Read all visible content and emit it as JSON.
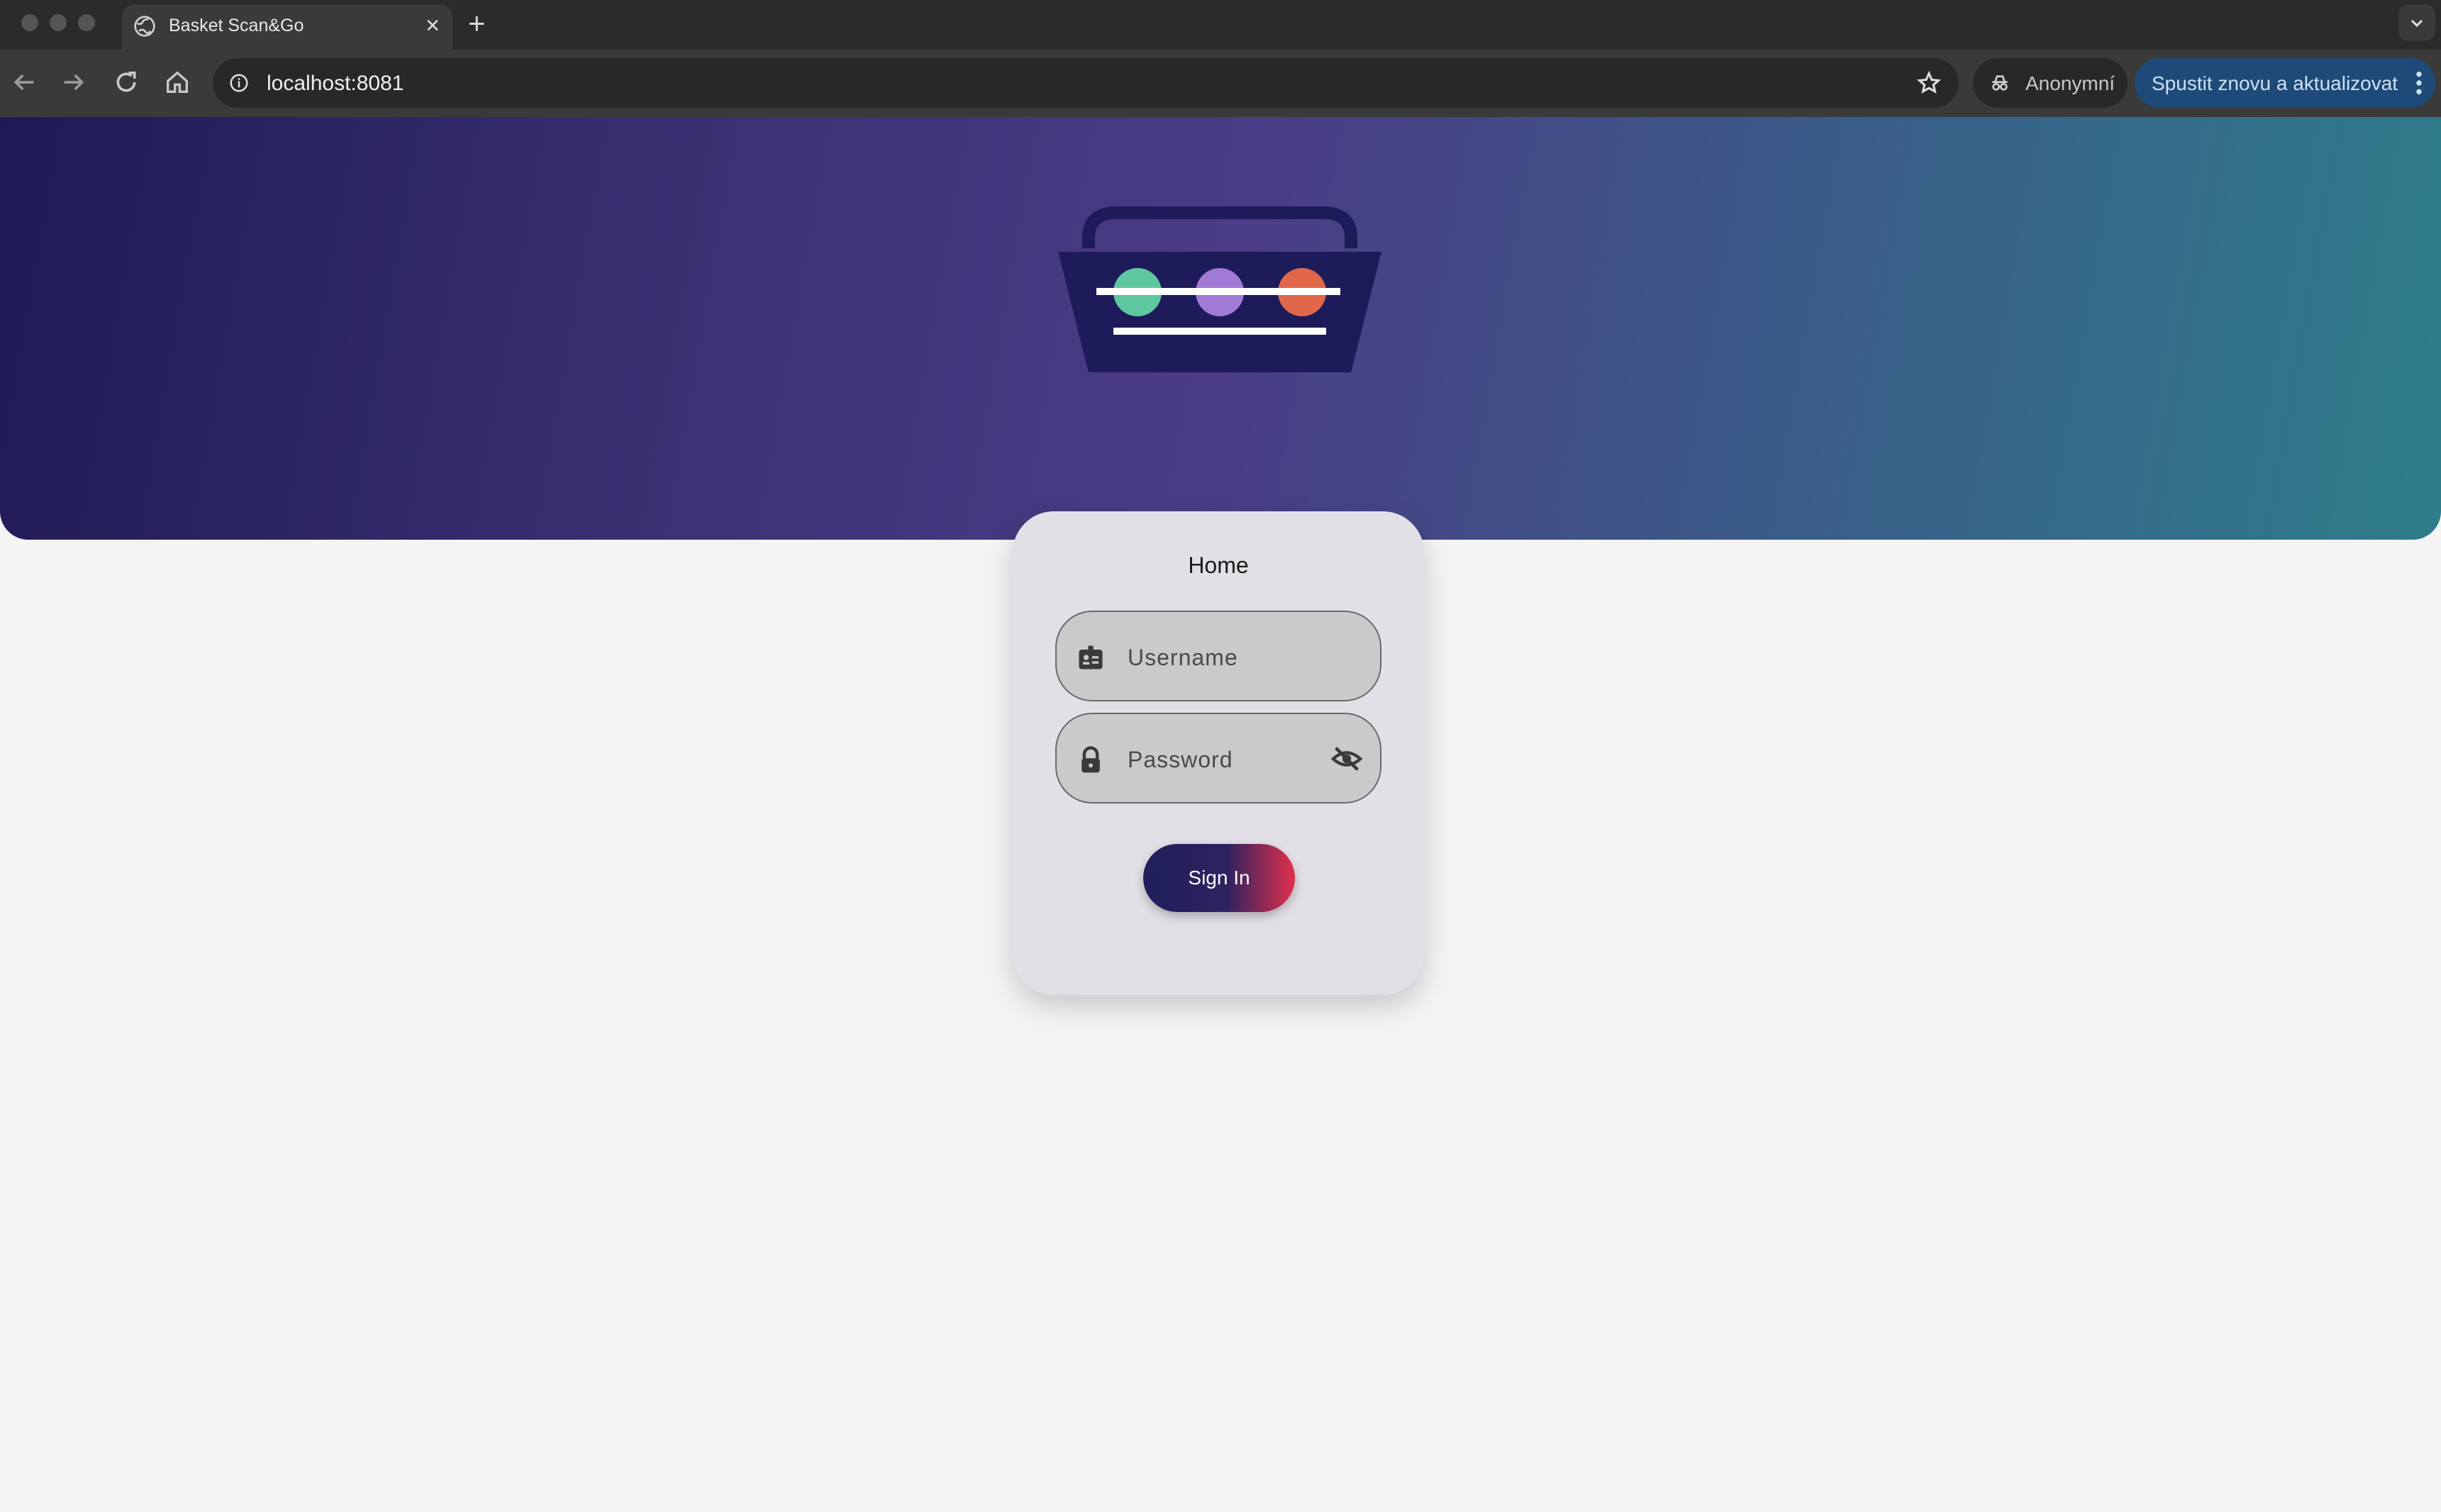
{
  "browser": {
    "tab_title": "Basket Scan&Go",
    "tab_close": "×",
    "new_tab": "+",
    "url": "localhost:8081",
    "profile_label": "Anonymní",
    "update_label": "Spustit znovu a aktualizovat",
    "icons": [
      "back-icon",
      "forward-icon",
      "reload-icon",
      "home-icon",
      "info-icon",
      "star-icon",
      "incognito-icon",
      "kebab-icon"
    ]
  },
  "logo": {
    "name": "basket-logo",
    "colors": {
      "body": "#1e1b5a",
      "dot1": "#5fc7a0",
      "dot2": "#a07ad6",
      "dot3": "#e0674a",
      "line": "#ffffff"
    }
  },
  "login": {
    "title": "Home",
    "username_placeholder": "Username",
    "password_placeholder": "Password",
    "signin_label": "Sign In"
  }
}
